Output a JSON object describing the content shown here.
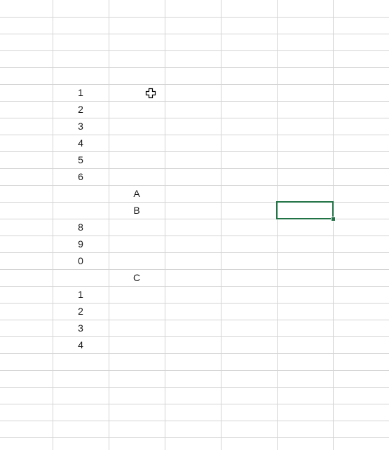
{
  "sheet": {
    "cells": [
      {
        "row": 5,
        "col": 1,
        "value": "1"
      },
      {
        "row": 6,
        "col": 1,
        "value": "2"
      },
      {
        "row": 7,
        "col": 1,
        "value": "3"
      },
      {
        "row": 8,
        "col": 1,
        "value": "4"
      },
      {
        "row": 9,
        "col": 1,
        "value": "5"
      },
      {
        "row": 10,
        "col": 1,
        "value": "6"
      },
      {
        "row": 11,
        "col": 2,
        "value": "A"
      },
      {
        "row": 12,
        "col": 2,
        "value": "B"
      },
      {
        "row": 13,
        "col": 1,
        "value": "8"
      },
      {
        "row": 14,
        "col": 1,
        "value": "9"
      },
      {
        "row": 15,
        "col": 1,
        "value": "0"
      },
      {
        "row": 16,
        "col": 2,
        "value": "C"
      },
      {
        "row": 17,
        "col": 1,
        "value": "1"
      },
      {
        "row": 18,
        "col": 1,
        "value": "2"
      },
      {
        "row": 19,
        "col": 1,
        "value": "3"
      },
      {
        "row": 20,
        "col": 1,
        "value": "4"
      }
    ],
    "selected_cell": {
      "row": 12,
      "col": 5
    },
    "cursor_cell": {
      "row": 5,
      "col": 2
    },
    "accent_color": "#217346",
    "gridline_color": "#d4d4d4"
  }
}
